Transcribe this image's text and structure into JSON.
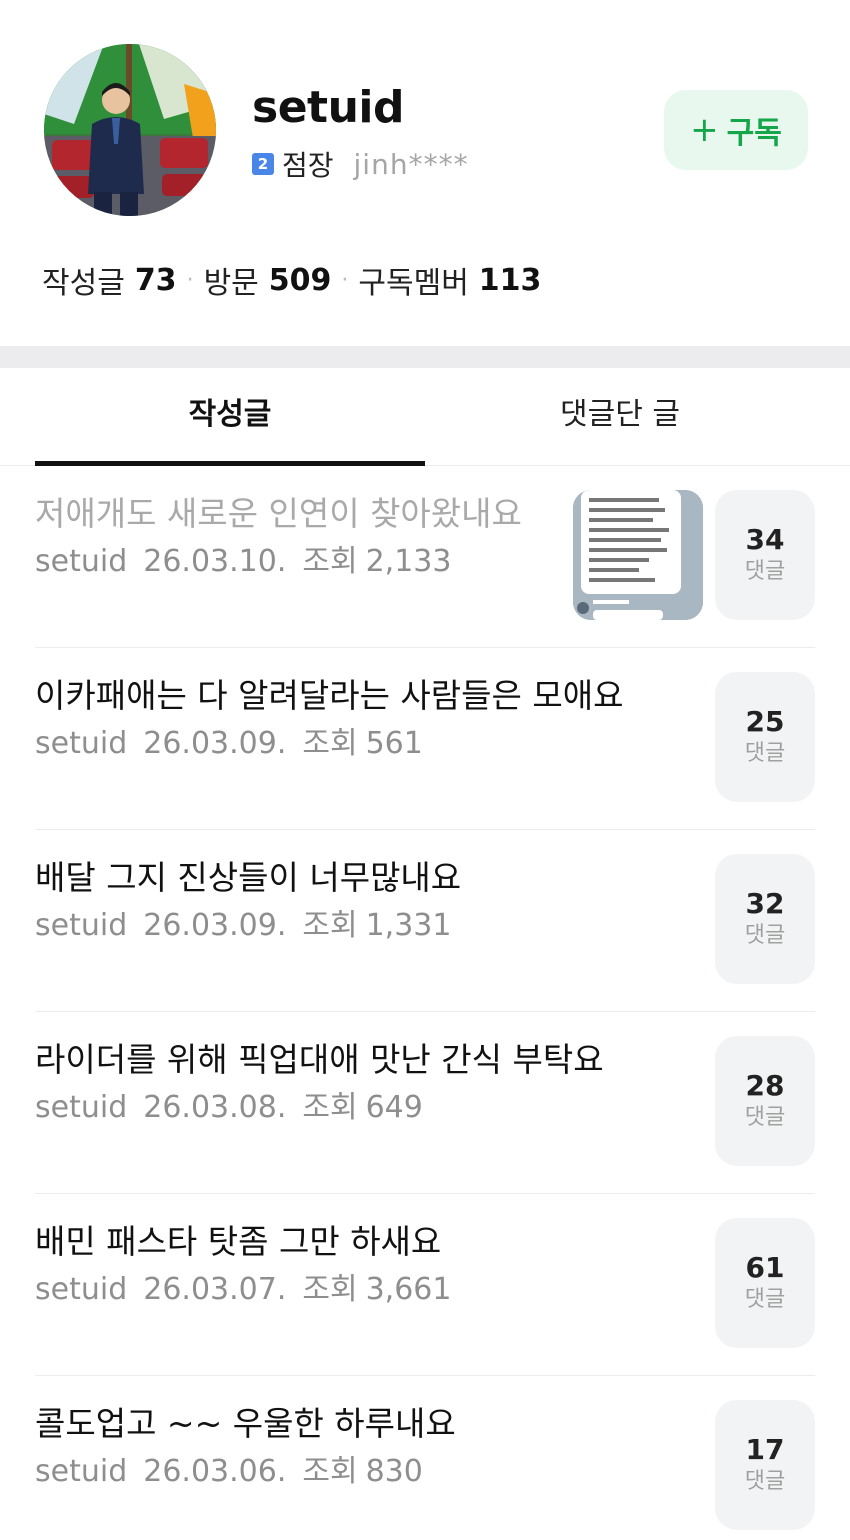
{
  "profile": {
    "name": "setuid",
    "level_badge": "2",
    "rank": "점장",
    "user_id": "jinh****",
    "subscribe_label": "구독",
    "subscribe_icon": "plus-icon",
    "accent_color": "#15a64a"
  },
  "stats": {
    "posts_label": "작성글",
    "posts_value": "73",
    "visits_label": "방문",
    "visits_value": "509",
    "members_label": "구독멤버",
    "members_value": "113"
  },
  "tabs": [
    {
      "label": "작성글",
      "active": true
    },
    {
      "label": "댓글단 글",
      "active": false
    }
  ],
  "comment_label": "댓글",
  "posts": [
    {
      "title": "저애개도 새로운 인연이 찾아왔내요",
      "author": "setuid",
      "date": "26.03.10.",
      "views_label": "조회",
      "views": "2,133",
      "comments": "34",
      "read": true,
      "has_thumbnail": true
    },
    {
      "title": "이카패애는 다 알려달라는 사람들은 모애요",
      "author": "setuid",
      "date": "26.03.09.",
      "views_label": "조회",
      "views": "561",
      "comments": "25",
      "read": false
    },
    {
      "title": "배달 그지 진상들이 너무많내요",
      "author": "setuid",
      "date": "26.03.09.",
      "views_label": "조회",
      "views": "1,331",
      "comments": "32",
      "read": false
    },
    {
      "title": "라이더를 위해 픽업대애 맛난 간식 부탁요",
      "author": "setuid",
      "date": "26.03.08.",
      "views_label": "조회",
      "views": "649",
      "comments": "28",
      "read": false
    },
    {
      "title": "배민 패스타 탓좀 그만 하새요",
      "author": "setuid",
      "date": "26.03.07.",
      "views_label": "조회",
      "views": "3,661",
      "comments": "61",
      "read": false
    },
    {
      "title": "콜도업고 ~~ 우울한 하루내요",
      "author": "setuid",
      "date": "26.03.06.",
      "views_label": "조회",
      "views": "830",
      "comments": "17",
      "read": false
    }
  ]
}
